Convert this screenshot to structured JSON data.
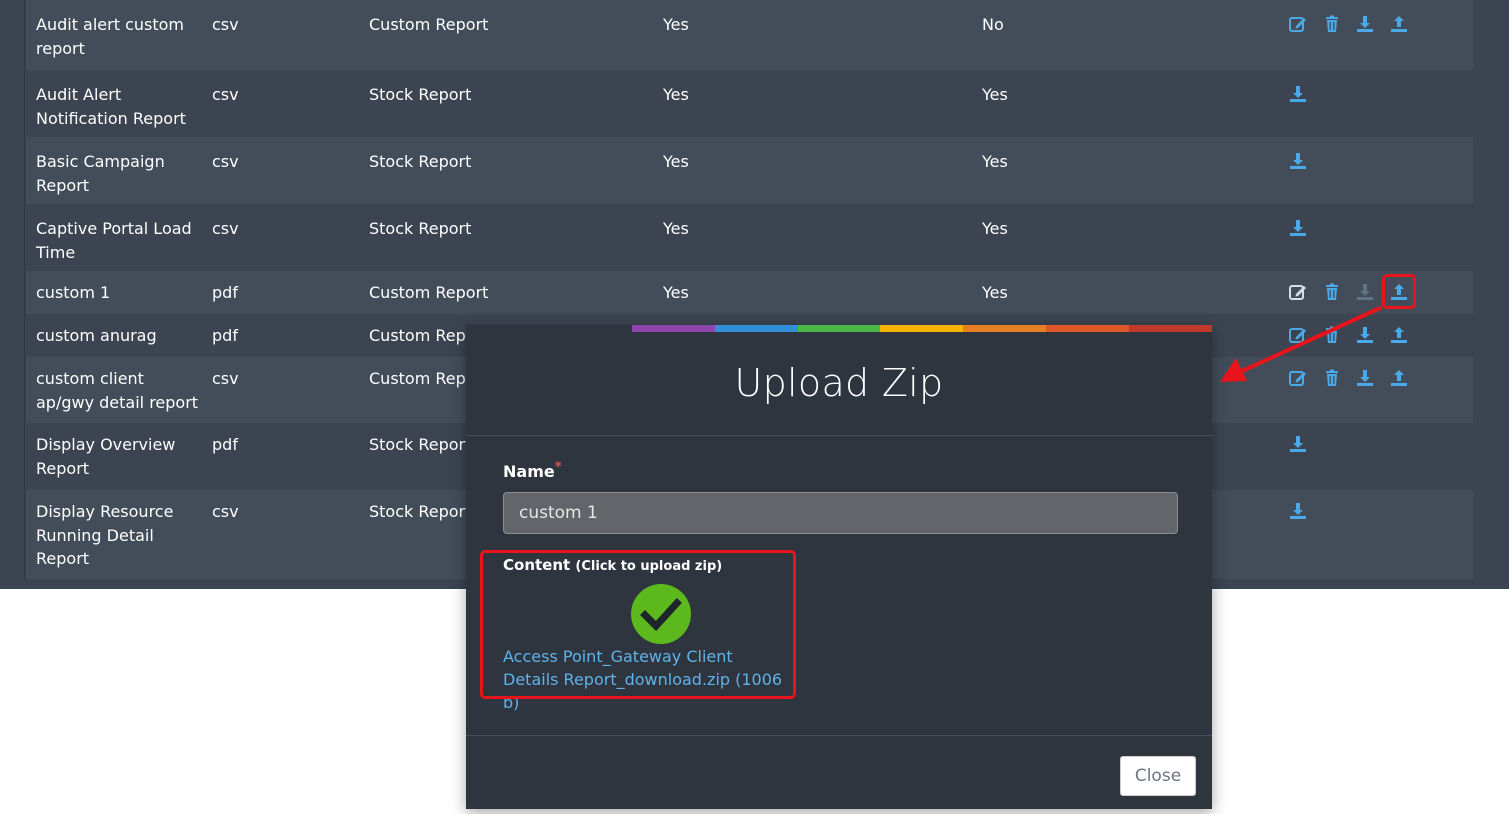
{
  "colors": {
    "accent_link": "#5fb3e8",
    "icon_blue": "#4aa9e9",
    "highlight_red": "#e8141b",
    "success_green": "#5cb81c"
  },
  "table": {
    "rows": [
      {
        "name": "Audit alert custom report",
        "format": "csv",
        "type": "Custom Report",
        "col4": "Yes",
        "col5": "No",
        "actions": [
          "edit-icon",
          "delete-icon",
          "download-icon",
          "upload-icon"
        ]
      },
      {
        "name": "Audit Alert Notification Report",
        "format": "csv",
        "type": "Stock Report",
        "col4": "Yes",
        "col5": "Yes",
        "actions": [
          "download-icon"
        ]
      },
      {
        "name": "Basic Campaign Report",
        "format": "csv",
        "type": "Stock Report",
        "col4": "Yes",
        "col5": "Yes",
        "actions": [
          "download-icon"
        ]
      },
      {
        "name": "Captive Portal Load Time",
        "format": "csv",
        "type": "Stock Report",
        "col4": "Yes",
        "col5": "Yes",
        "actions": [
          "download-icon"
        ]
      },
      {
        "name": "custom 1",
        "format": "pdf",
        "type": "Custom Report",
        "col4": "Yes",
        "col5": "Yes",
        "actions": [
          "edit-icon",
          "delete-icon",
          "download-icon",
          "upload-icon"
        ]
      },
      {
        "name": "custom anurag",
        "format": "pdf",
        "type": "Custom Report",
        "col4": "",
        "col5": "",
        "actions": [
          "edit-icon",
          "delete-icon",
          "download-icon",
          "upload-icon"
        ]
      },
      {
        "name": "custom client ap/gwy detail report",
        "format": "csv",
        "type": "Custom Report",
        "col4": "",
        "col5": "",
        "actions": [
          "edit-icon",
          "delete-icon",
          "download-icon",
          "upload-icon"
        ]
      },
      {
        "name": "Display Overview Report",
        "format": "pdf",
        "type": "Stock Report",
        "col4": "",
        "col5": "",
        "actions": [
          "download-icon"
        ]
      },
      {
        "name": "Display Resource Running Detail Report",
        "format": "csv",
        "type": "Stock Report",
        "col4": "",
        "col5": "",
        "actions": [
          "download-icon"
        ]
      }
    ]
  },
  "modal": {
    "title": "Upload Zip",
    "name_label": "Name",
    "required_mark": "*",
    "name_value": "custom 1",
    "content_label": "Content",
    "content_hint": "(Click to upload zip)",
    "file_link": "Access Point_Gateway Client Details Report_download.zip (1006 b)",
    "close_label": "Close",
    "stripe_colors": [
      "#2e353f",
      "#2e353f",
      "#8e44ad",
      "#2f8fd8",
      "#4cb848",
      "#f5b400",
      "#e67e22",
      "#e0572a",
      "#c0392b"
    ]
  }
}
